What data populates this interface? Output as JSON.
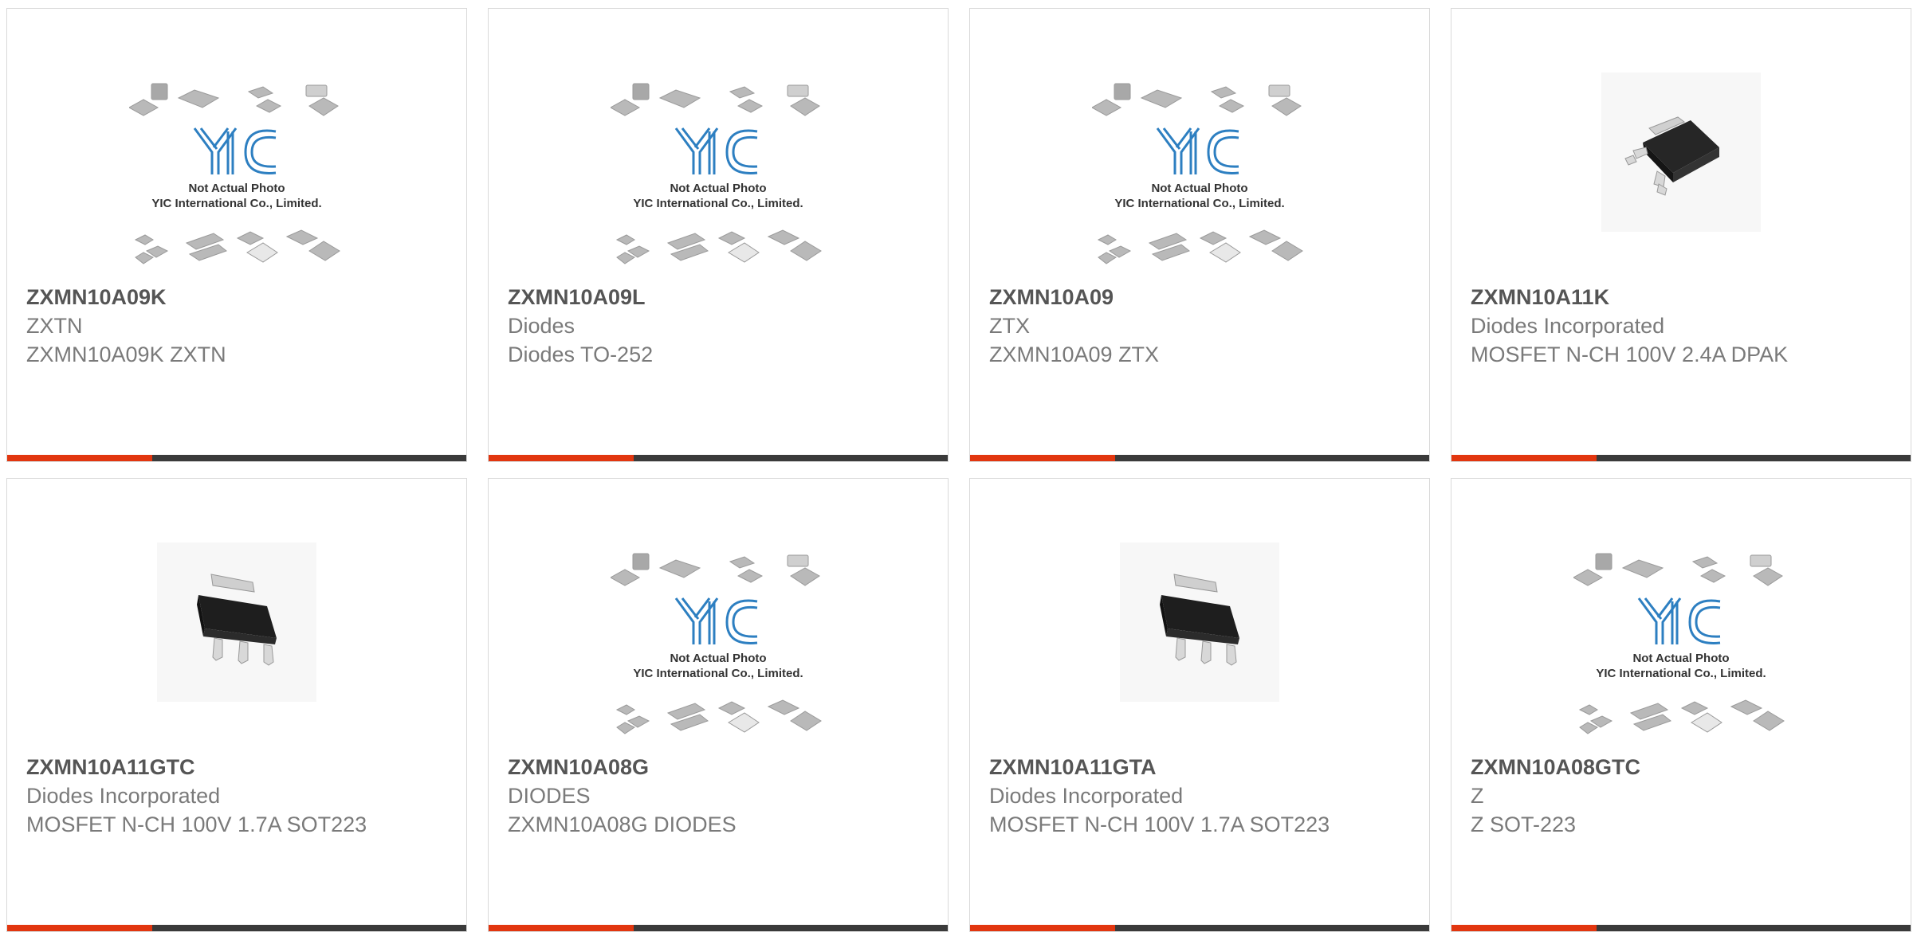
{
  "brand_logo_text": "YIC",
  "placeholder_caption_1": "Not Actual Photo",
  "placeholder_caption_2": "YIC International Co., Limited.",
  "colors": {
    "accent": "#e2360f",
    "bar": "#3a3a3a",
    "part_number": "#555555",
    "text": "#7a7a7a",
    "border": "#d9d9d9"
  },
  "products": [
    {
      "part_number": "ZXMN10A09K",
      "manufacturer": "ZXTN",
      "description": "ZXMN10A09K ZXTN",
      "image": "placeholder-logo"
    },
    {
      "part_number": "ZXMN10A09L",
      "manufacturer": "Diodes",
      "description": "Diodes TO-252",
      "image": "placeholder-logo"
    },
    {
      "part_number": "ZXMN10A09",
      "manufacturer": "ZTX",
      "description": "ZXMN10A09 ZTX",
      "image": "placeholder-logo"
    },
    {
      "part_number": "ZXMN10A11K",
      "manufacturer": "Diodes Incorporated",
      "description": "MOSFET N-CH 100V 2.4A DPAK",
      "image": "dpak-package"
    },
    {
      "part_number": "ZXMN10A11GTC",
      "manufacturer": "Diodes Incorporated",
      "description": "MOSFET N-CH 100V 1.7A SOT223",
      "image": "sot223-package"
    },
    {
      "part_number": "ZXMN10A08G",
      "manufacturer": "DIODES",
      "description": "ZXMN10A08G DIODES",
      "image": "placeholder-logo"
    },
    {
      "part_number": "ZXMN10A11GTA",
      "manufacturer": "Diodes Incorporated",
      "description": "MOSFET N-CH 100V 1.7A SOT223",
      "image": "sot223-package"
    },
    {
      "part_number": "ZXMN10A08GTC",
      "manufacturer": "Z",
      "description": "Z SOT-223",
      "image": "placeholder-logo"
    }
  ]
}
